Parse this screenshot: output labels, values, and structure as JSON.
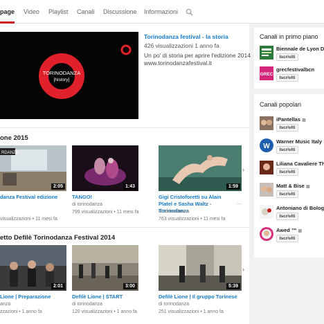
{
  "tabs": [
    {
      "label": "page",
      "active": true
    },
    {
      "label": "Video",
      "active": false
    },
    {
      "label": "Playlist",
      "active": false
    },
    {
      "label": "Canali",
      "active": false
    },
    {
      "label": "Discussione",
      "active": false
    },
    {
      "label": "Informazioni",
      "active": false
    }
  ],
  "featured": {
    "title": "Torinodanza festival - la storia",
    "meta": "426 visualizzazioni   1 anno fa",
    "desc1": "Un po' di storia per aprire l'edizione 2014",
    "desc2": "www.torinodanzafestival.it",
    "logo_line1": "TORINODANZA",
    "logo_line2": "[history]"
  },
  "shelf1": {
    "title": "one 2015",
    "videos": [
      {
        "title": "danza Festival edizione",
        "channel": "di torinodanza",
        "meta": "visualizzazioni  • 11 mesi fa",
        "duration": "2:05",
        "badge": "RDANZA"
      },
      {
        "title": "TANGO!",
        "channel": "di torinodanza",
        "meta": "799 visualizzazioni • 11 mesi fa",
        "duration": "1:43"
      },
      {
        "title": "Gigi Cristoforetti su Alain Platel e Sasha Waltz - Torinodanza",
        "channel": "di torinodanza",
        "meta": "763 visualizzazioni • 11 mesi fa",
        "duration": "1:59"
      }
    ]
  },
  "shelf2": {
    "title": "etto Defilè Torinodanza Festival 2014",
    "videos": [
      {
        "title": "Lione | Preparazione",
        "channel": "anza",
        "meta": "zzazioni • 1 anno fa",
        "duration": "2:01"
      },
      {
        "title": "Defilè Lione | START",
        "channel": "di torinodanza",
        "meta": "120 visualizzazioni • 1 anno fa",
        "duration": "3:00"
      },
      {
        "title": "Defilè Lione | Il gruppo Torinese",
        "channel": "di torinodanza",
        "meta": "251 visualizzazioni • 1 anno fa",
        "duration": "5:39"
      }
    ]
  },
  "featured_channels": {
    "title": "Canali in primo piano",
    "items": [
      {
        "name": "Biennale de Lyon D...",
        "button": "Iscriviti",
        "icon": "biennale-logo"
      },
      {
        "name": "grecfestivalbcn",
        "button": "Iscriviti",
        "icon": "grec-logo",
        "logo_text": "GREC"
      }
    ]
  },
  "popular_channels": {
    "title": "Canali popolari",
    "items": [
      {
        "name": "iPantellas",
        "button": "Iscriviti",
        "verified": true
      },
      {
        "name": "Warner Music Italy",
        "button": "Iscriviti",
        "verified": true
      },
      {
        "name": "Liliana Cavaliere Th",
        "button": "Iscriviti"
      },
      {
        "name": "Matt & Bise",
        "button": "Iscriviti",
        "verified": true
      },
      {
        "name": "Antoniano di Bolog...",
        "button": "Iscriviti"
      },
      {
        "name": "Awed ™",
        "button": "Iscriviti",
        "verified": true
      }
    ]
  },
  "colors": {
    "accent": "#cc181e",
    "link": "#167ac6"
  },
  "icons": {
    "search": "search-icon",
    "next": "chevron-right-icon",
    "verified": "verified-icon",
    "more": "more-icon"
  }
}
